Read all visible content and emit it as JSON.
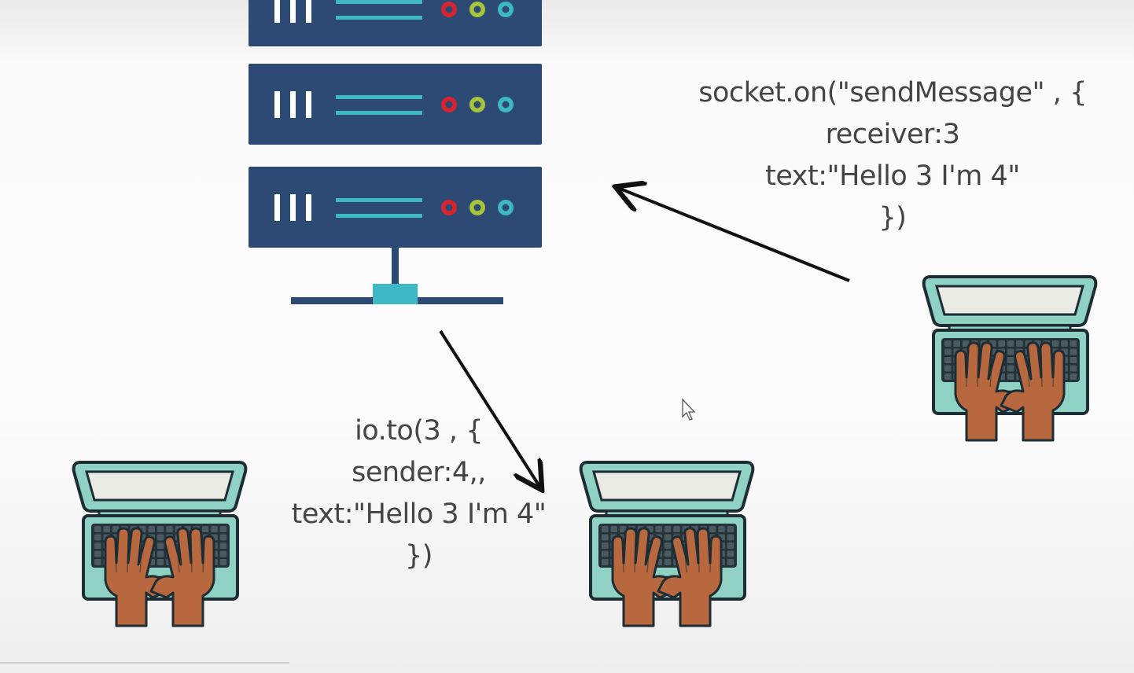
{
  "diagram": {
    "colors": {
      "server_body": "#2c4a74",
      "server_stripe": "#3fb8c6",
      "light_red": "#d8232f",
      "light_green": "#a8c43a",
      "light_cyan": "#3fb8c6",
      "laptop_body": "#8fd1c3",
      "laptop_screen": "#ebebe6",
      "laptop_outline": "#1e2d33",
      "hand_skin": "#b8683e",
      "arrow": "#111111",
      "code_text": "#444444"
    },
    "server": {
      "name": "server-rack",
      "icon": "server-icon"
    },
    "laptops": [
      {
        "name": "client-laptop-left",
        "icon": "laptop-typing-icon"
      },
      {
        "name": "client-laptop-middle",
        "icon": "laptop-typing-icon"
      },
      {
        "name": "client-laptop-right",
        "icon": "laptop-typing-icon"
      }
    ],
    "send_message_code": {
      "lines": [
        "socket.on(\"sendMessage\" , {",
        "receiver:3",
        "text:\"Hello 3 I'm 4\"",
        "})"
      ]
    },
    "emit_code": {
      "lines": [
        "io.to(3 , {",
        "sender:4,,",
        "text:\"Hello 3 I'm 4\"",
        "})"
      ]
    }
  }
}
